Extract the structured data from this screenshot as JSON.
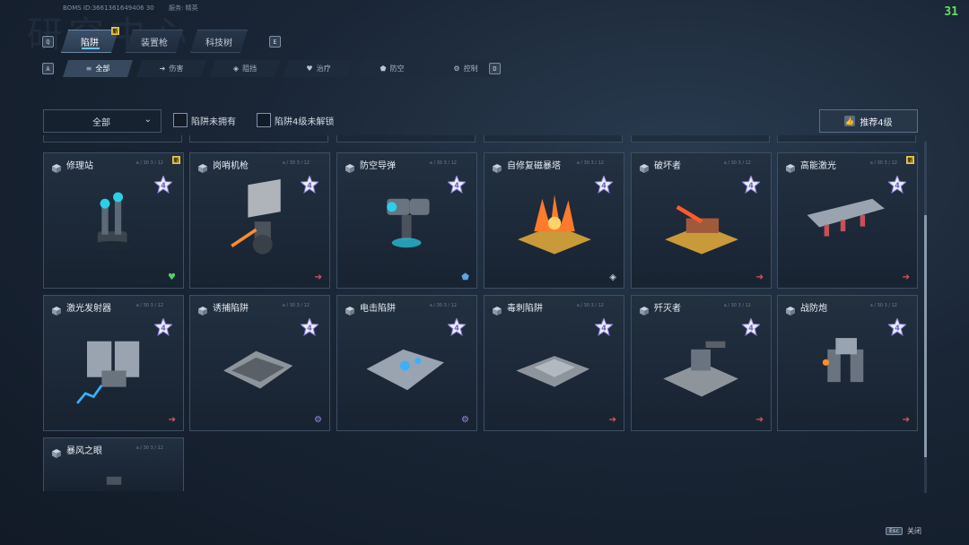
{
  "header": {
    "watermark": "研究中心",
    "user_id_text": "BOMS  ID:3661361649406 30",
    "user_extra": "服务:  精英",
    "fps": "31"
  },
  "main_tabs": {
    "left_key": "Q",
    "right_key": "E",
    "items": [
      {
        "label": "陷阱",
        "active": true,
        "new": "新"
      },
      {
        "label": "装置枪",
        "active": false
      },
      {
        "label": "科技树",
        "active": false
      }
    ]
  },
  "sub_tabs": {
    "left_key": "A",
    "right_key": "D",
    "items": [
      {
        "label": "全部",
        "icon": "list-icon",
        "glyph": "≡"
      },
      {
        "label": "伤害",
        "icon": "arrow-icon",
        "glyph": "➔"
      },
      {
        "label": "阻挡",
        "icon": "shield-half-icon",
        "glyph": "◈"
      },
      {
        "label": "治疗",
        "icon": "heart-icon",
        "glyph": "♥"
      },
      {
        "label": "防空",
        "icon": "shield-icon",
        "glyph": "⬟"
      },
      {
        "label": "控制",
        "icon": "gear-icon",
        "glyph": "⚙"
      }
    ]
  },
  "filters": {
    "select_value": "全部",
    "checkbox1_label": "陷阱未拥有",
    "checkbox2_label": "陷阱4级未解锁",
    "recommend_label": "推荐4级"
  },
  "cards": [
    {
      "name": "修理站",
      "tag": "a / 30 3 / 12",
      "new": "新",
      "bottom_icon": "heart-icon",
      "bottom_glyph": "♥",
      "bottom_color": "#55d06a",
      "art": "repair"
    },
    {
      "name": "岗哨机枪",
      "tag": "a / 30 3 / 12",
      "bottom_icon": "arrow-icon",
      "bottom_glyph": "➔",
      "bottom_color": "#e0555a",
      "art": "sentry"
    },
    {
      "name": "防空导弹",
      "tag": "a / 30 3 / 12",
      "bottom_icon": "shield-icon",
      "bottom_glyph": "⬟",
      "bottom_color": "#5aa6e6",
      "art": "missile"
    },
    {
      "name": "自修复磁暴塔",
      "tag": "a / 30 3 / 12",
      "bottom_icon": "shield-half-icon",
      "bottom_glyph": "◈",
      "bottom_color": "#c7ced6",
      "art": "tesla"
    },
    {
      "name": "破坏者",
      "tag": "a / 30 3 / 12",
      "bottom_icon": "arrow-icon",
      "bottom_glyph": "➔",
      "bottom_color": "#e0555a",
      "art": "destroyer"
    },
    {
      "name": "高能激光",
      "tag": "a / 30 3 / 12",
      "new": "新",
      "bottom_icon": "arrow-icon",
      "bottom_glyph": "➔",
      "bottom_color": "#e0555a",
      "art": "laser"
    },
    {
      "name": "激光发射器",
      "tag": "a / 30 3 / 12",
      "bottom_icon": "arrow-icon",
      "bottom_glyph": "➔",
      "bottom_color": "#e0555a",
      "art": "emitter"
    },
    {
      "name": "诱捕陷阱",
      "tag": "a / 30 3 / 12",
      "bottom_icon": "gear-icon",
      "bottom_glyph": "⚙",
      "bottom_color": "#9a8be6",
      "art": "trap"
    },
    {
      "name": "电击陷阱",
      "tag": "a / 30 3 / 12",
      "bottom_icon": "gear-icon",
      "bottom_glyph": "⚙",
      "bottom_color": "#9a8be6",
      "art": "shock"
    },
    {
      "name": "毒刺陷阱",
      "tag": "a / 30 3 / 12",
      "bottom_icon": "arrow-icon",
      "bottom_glyph": "➔",
      "bottom_color": "#e0555a",
      "art": "spike"
    },
    {
      "name": "歼灭者",
      "tag": "a / 30 3 / 12",
      "bottom_icon": "arrow-icon",
      "bottom_glyph": "➔",
      "bottom_color": "#e0555a",
      "art": "annihilator"
    },
    {
      "name": "战防炮",
      "tag": "a / 30 3 / 12",
      "bottom_icon": "arrow-icon",
      "bottom_glyph": "➔",
      "bottom_color": "#e0555a",
      "art": "cannon"
    },
    {
      "name": "暴风之眼",
      "tag": "a / 30 3 / 12",
      "art": "storm"
    }
  ],
  "star_level": "4",
  "footer": {
    "esc_key": "Esc",
    "close_label": "关闭"
  },
  "colors": {
    "accent": "#6fc3ff",
    "new_badge": "#e4c64a",
    "damage": "#e0555a",
    "heal": "#55d06a",
    "control": "#9a8be6"
  }
}
